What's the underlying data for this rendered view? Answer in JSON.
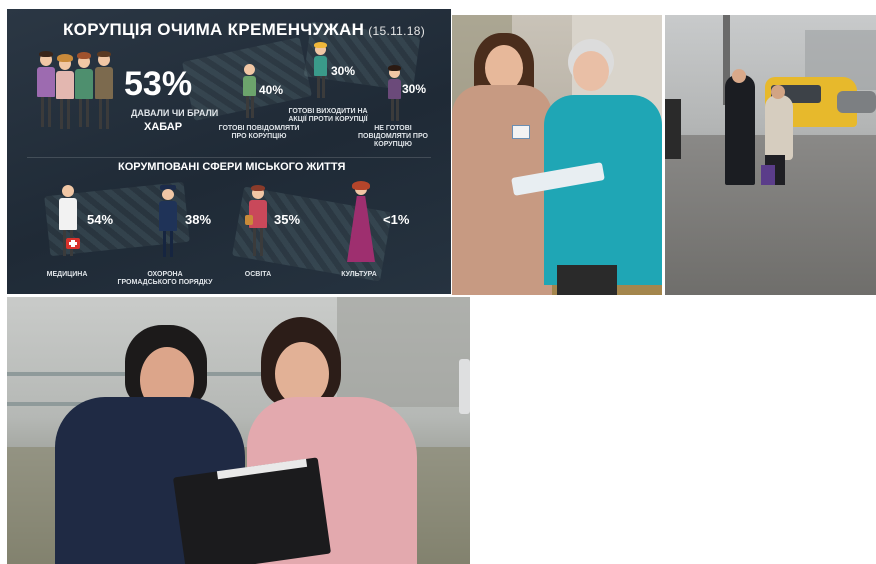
{
  "infographic": {
    "title": "КОРУПЦІЯ ОЧИМА КРЕМЕНЧУЖАН",
    "date": "(15.11.18)",
    "main_stat": {
      "value": "53%",
      "caption_line1": "ДАВАЛИ ЧИ БРАЛИ",
      "caption_line2": "ХАБАР"
    },
    "stats": [
      {
        "value": "40%",
        "caption": "ГОТОВІ ПОВІДОМЛЯТИ ПРО КОРУПЦІЮ"
      },
      {
        "value": "30%",
        "caption": "ГОТОВІ ВИХОДИТИ НА АКЦІЇ ПРОТИ КОРУПЦІЇ"
      },
      {
        "value": "30%",
        "caption": "НЕ ГОТОВІ ПОВІДОМЛЯТИ ПРО КОРУПЦІЮ"
      }
    ],
    "section_title": "КОРУМПОВАНІ СФЕРИ МІСЬКОГО ЖИТТЯ",
    "spheres": [
      {
        "value": "54%",
        "label": "МЕДИЦИНА"
      },
      {
        "value": "38%",
        "label": "ОХОРОНА ГРОМАДСЬКОГО ПОРЯДКУ"
      },
      {
        "value": "35%",
        "label": "ОСВІТА"
      },
      {
        "value": "<1%",
        "label": "КУЛЬТУРА"
      }
    ]
  },
  "photos": [
    {
      "name": "survey-volunteer-with-elderly-woman-photo",
      "icon": "photo"
    },
    {
      "name": "street-survey-foggy-photo",
      "icon": "photo"
    },
    {
      "name": "survey-in-fog-clipboard-photo",
      "icon": "photo"
    }
  ],
  "colors": {
    "panel_bg": "#243140",
    "text": "#ffffff",
    "medicine_red": "#d8322c"
  }
}
